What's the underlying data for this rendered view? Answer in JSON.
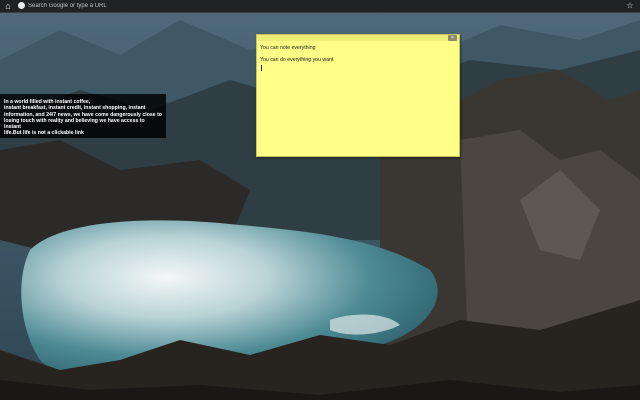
{
  "browser": {
    "omnibox_placeholder": "Search Google or type a URL",
    "home_icon": "home-icon",
    "google_icon": "google-icon",
    "bookmark_icon": "star-icon"
  },
  "quote": {
    "lines": [
      "In a world filled with instant coffee,",
      "instant breakfast, instant credit, instant shopping, instant",
      "information, and 24/7 news, we have come dangerously close to",
      "losing touch with reality and believing we have access to instant",
      "life.But life is not a clickable link"
    ]
  },
  "sticky_note": {
    "close_label": "×",
    "line1": "You can note everything",
    "line2": "You can do everything you want",
    "background_color": "#ffff88"
  }
}
